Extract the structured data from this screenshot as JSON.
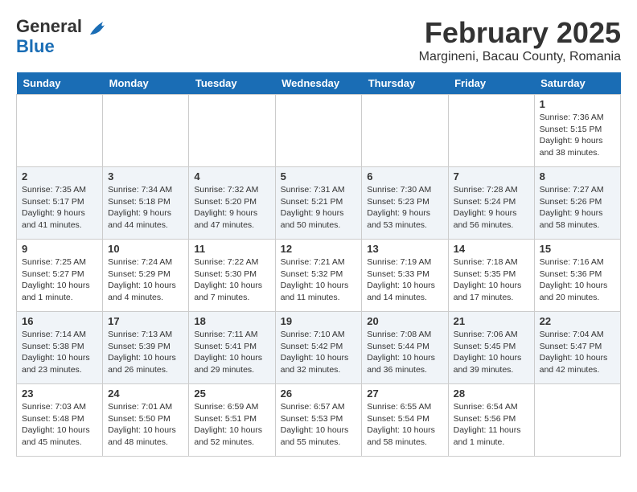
{
  "header": {
    "logo_line1": "General",
    "logo_line2": "Blue",
    "month": "February 2025",
    "location": "Margineni, Bacau County, Romania"
  },
  "weekdays": [
    "Sunday",
    "Monday",
    "Tuesday",
    "Wednesday",
    "Thursday",
    "Friday",
    "Saturday"
  ],
  "weeks": [
    [
      {
        "day": "",
        "info": ""
      },
      {
        "day": "",
        "info": ""
      },
      {
        "day": "",
        "info": ""
      },
      {
        "day": "",
        "info": ""
      },
      {
        "day": "",
        "info": ""
      },
      {
        "day": "",
        "info": ""
      },
      {
        "day": "1",
        "info": "Sunrise: 7:36 AM\nSunset: 5:15 PM\nDaylight: 9 hours and 38 minutes."
      }
    ],
    [
      {
        "day": "2",
        "info": "Sunrise: 7:35 AM\nSunset: 5:17 PM\nDaylight: 9 hours and 41 minutes."
      },
      {
        "day": "3",
        "info": "Sunrise: 7:34 AM\nSunset: 5:18 PM\nDaylight: 9 hours and 44 minutes."
      },
      {
        "day": "4",
        "info": "Sunrise: 7:32 AM\nSunset: 5:20 PM\nDaylight: 9 hours and 47 minutes."
      },
      {
        "day": "5",
        "info": "Sunrise: 7:31 AM\nSunset: 5:21 PM\nDaylight: 9 hours and 50 minutes."
      },
      {
        "day": "6",
        "info": "Sunrise: 7:30 AM\nSunset: 5:23 PM\nDaylight: 9 hours and 53 minutes."
      },
      {
        "day": "7",
        "info": "Sunrise: 7:28 AM\nSunset: 5:24 PM\nDaylight: 9 hours and 56 minutes."
      },
      {
        "day": "8",
        "info": "Sunrise: 7:27 AM\nSunset: 5:26 PM\nDaylight: 9 hours and 58 minutes."
      }
    ],
    [
      {
        "day": "9",
        "info": "Sunrise: 7:25 AM\nSunset: 5:27 PM\nDaylight: 10 hours and 1 minute."
      },
      {
        "day": "10",
        "info": "Sunrise: 7:24 AM\nSunset: 5:29 PM\nDaylight: 10 hours and 4 minutes."
      },
      {
        "day": "11",
        "info": "Sunrise: 7:22 AM\nSunset: 5:30 PM\nDaylight: 10 hours and 7 minutes."
      },
      {
        "day": "12",
        "info": "Sunrise: 7:21 AM\nSunset: 5:32 PM\nDaylight: 10 hours and 11 minutes."
      },
      {
        "day": "13",
        "info": "Sunrise: 7:19 AM\nSunset: 5:33 PM\nDaylight: 10 hours and 14 minutes."
      },
      {
        "day": "14",
        "info": "Sunrise: 7:18 AM\nSunset: 5:35 PM\nDaylight: 10 hours and 17 minutes."
      },
      {
        "day": "15",
        "info": "Sunrise: 7:16 AM\nSunset: 5:36 PM\nDaylight: 10 hours and 20 minutes."
      }
    ],
    [
      {
        "day": "16",
        "info": "Sunrise: 7:14 AM\nSunset: 5:38 PM\nDaylight: 10 hours and 23 minutes."
      },
      {
        "day": "17",
        "info": "Sunrise: 7:13 AM\nSunset: 5:39 PM\nDaylight: 10 hours and 26 minutes."
      },
      {
        "day": "18",
        "info": "Sunrise: 7:11 AM\nSunset: 5:41 PM\nDaylight: 10 hours and 29 minutes."
      },
      {
        "day": "19",
        "info": "Sunrise: 7:10 AM\nSunset: 5:42 PM\nDaylight: 10 hours and 32 minutes."
      },
      {
        "day": "20",
        "info": "Sunrise: 7:08 AM\nSunset: 5:44 PM\nDaylight: 10 hours and 36 minutes."
      },
      {
        "day": "21",
        "info": "Sunrise: 7:06 AM\nSunset: 5:45 PM\nDaylight: 10 hours and 39 minutes."
      },
      {
        "day": "22",
        "info": "Sunrise: 7:04 AM\nSunset: 5:47 PM\nDaylight: 10 hours and 42 minutes."
      }
    ],
    [
      {
        "day": "23",
        "info": "Sunrise: 7:03 AM\nSunset: 5:48 PM\nDaylight: 10 hours and 45 minutes."
      },
      {
        "day": "24",
        "info": "Sunrise: 7:01 AM\nSunset: 5:50 PM\nDaylight: 10 hours and 48 minutes."
      },
      {
        "day": "25",
        "info": "Sunrise: 6:59 AM\nSunset: 5:51 PM\nDaylight: 10 hours and 52 minutes."
      },
      {
        "day": "26",
        "info": "Sunrise: 6:57 AM\nSunset: 5:53 PM\nDaylight: 10 hours and 55 minutes."
      },
      {
        "day": "27",
        "info": "Sunrise: 6:55 AM\nSunset: 5:54 PM\nDaylight: 10 hours and 58 minutes."
      },
      {
        "day": "28",
        "info": "Sunrise: 6:54 AM\nSunset: 5:56 PM\nDaylight: 11 hours and 1 minute."
      },
      {
        "day": "",
        "info": ""
      }
    ]
  ]
}
